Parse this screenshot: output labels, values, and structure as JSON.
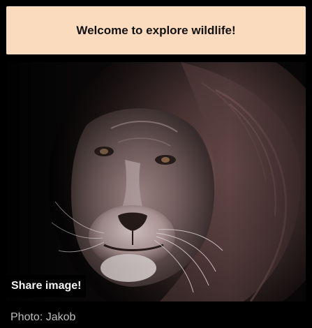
{
  "banner": {
    "title": "Welcome to explore wildlife!"
  },
  "photo": {
    "subject": "lion-portrait",
    "share_label": "Share image!"
  },
  "caption": {
    "text": "Photo: Jakob"
  },
  "colors": {
    "banner_bg": "#fbdbbd",
    "page_bg": "#000000",
    "caption_text": "#bdbdbd"
  }
}
